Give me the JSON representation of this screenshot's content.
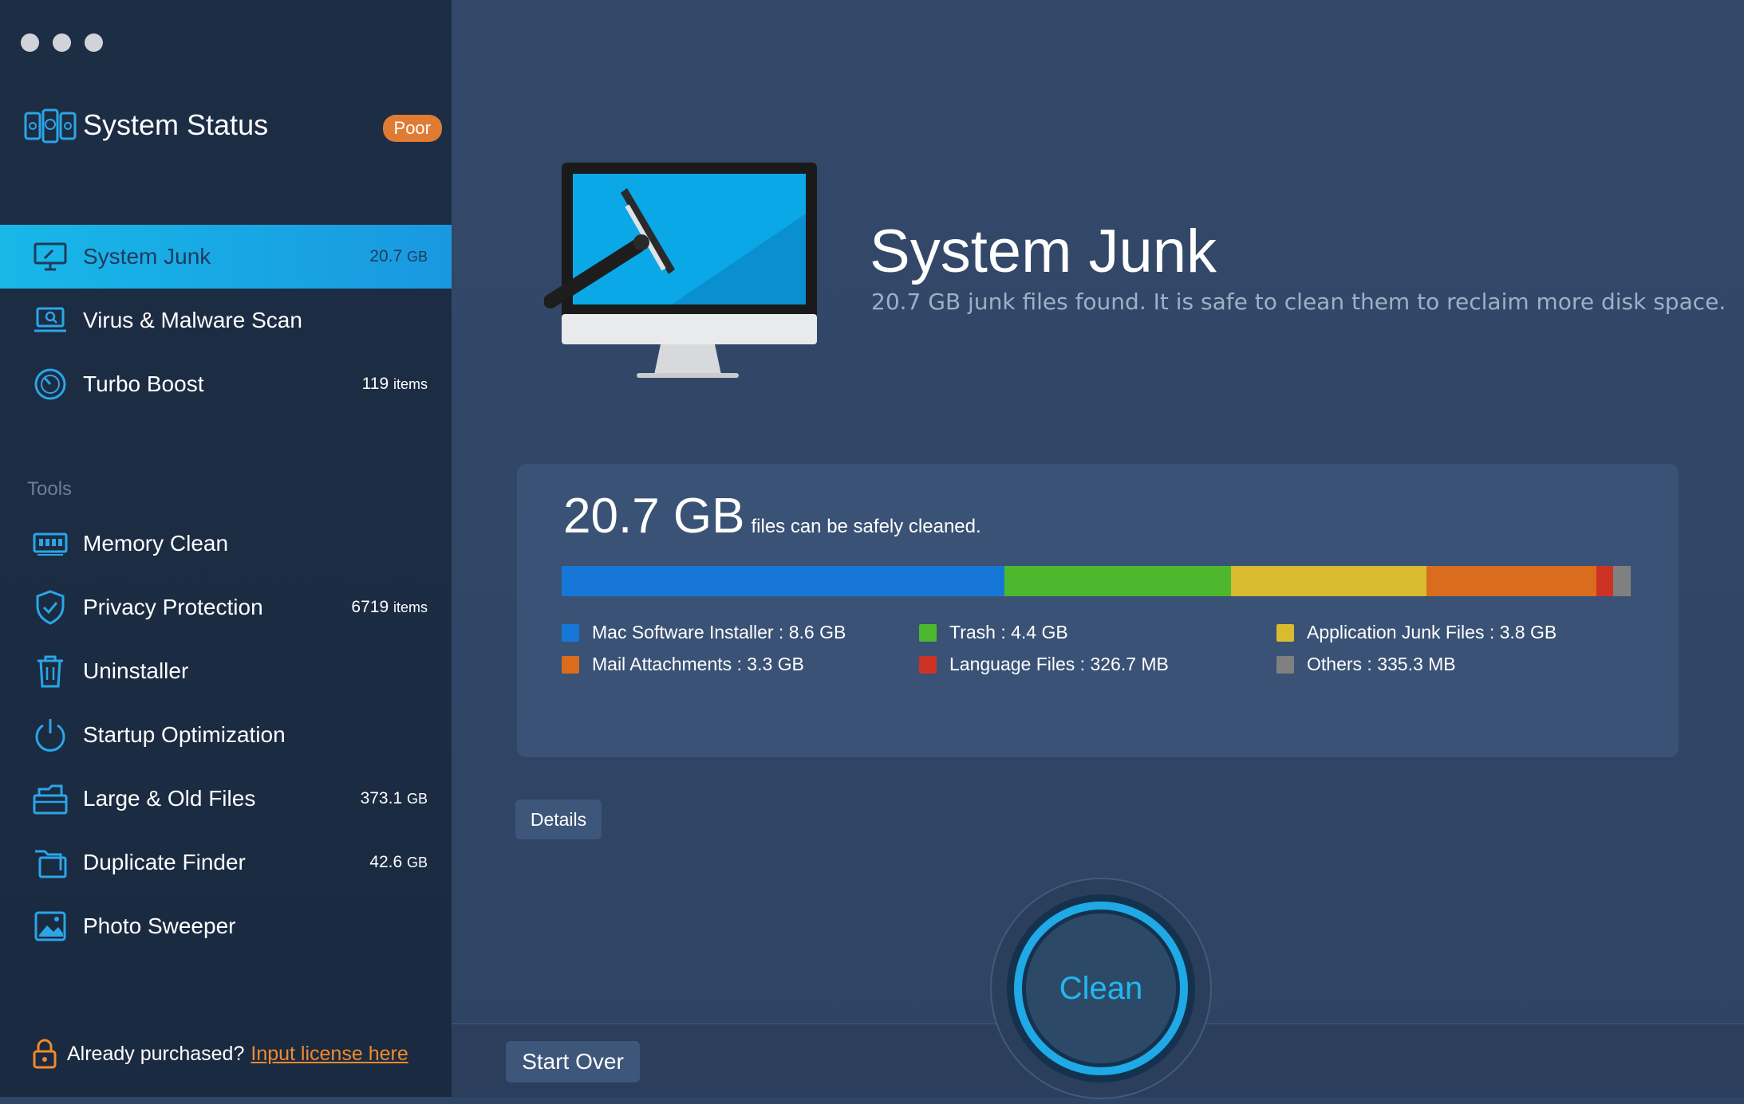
{
  "sidebar": {
    "status": {
      "title": "System Status",
      "badge": "Poor"
    },
    "items": [
      {
        "label": "System Junk",
        "meta_value": "20.7",
        "meta_unit": "GB",
        "active": true
      },
      {
        "label": "Virus & Malware Scan",
        "meta_value": "",
        "meta_unit": ""
      },
      {
        "label": "Turbo Boost",
        "meta_value": "119",
        "meta_unit": "items"
      }
    ],
    "tools_label": "Tools",
    "tools": [
      {
        "label": "Memory Clean",
        "meta_value": "",
        "meta_unit": ""
      },
      {
        "label": "Privacy Protection",
        "meta_value": "6719",
        "meta_unit": "items"
      },
      {
        "label": "Uninstaller",
        "meta_value": "",
        "meta_unit": ""
      },
      {
        "label": "Startup Optimization",
        "meta_value": "",
        "meta_unit": ""
      },
      {
        "label": "Large & Old Files",
        "meta_value": "373.1",
        "meta_unit": "GB"
      },
      {
        "label": "Duplicate Finder",
        "meta_value": "42.6",
        "meta_unit": "GB"
      },
      {
        "label": "Photo Sweeper",
        "meta_value": "",
        "meta_unit": ""
      }
    ],
    "license": {
      "text": "Already purchased?",
      "link": "Input license here"
    }
  },
  "main": {
    "title": "System Junk",
    "subtitle": "20.7 GB junk files found.  It is safe to clean them to reclaim more disk space.",
    "summary": {
      "amount": "20.7 GB",
      "text": "files can be safely cleaned."
    },
    "breakdown": [
      {
        "label": "Mac Software Installer : 8.6 GB",
        "value_gb": 8.6,
        "color": "#1677d9"
      },
      {
        "label": "Trash : 4.4 GB",
        "value_gb": 4.4,
        "color": "#4db82e"
      },
      {
        "label": "Application Junk Files : 3.8 GB",
        "value_gb": 3.8,
        "color": "#d8bb2e"
      },
      {
        "label": "Mail Attachments : 3.3 GB",
        "value_gb": 3.3,
        "color": "#d96c1d"
      },
      {
        "label": "Language Files : 326.7 MB",
        "value_gb": 0.3267,
        "color": "#cc3325"
      },
      {
        "label": "Others : 335.3 MB",
        "value_gb": 0.3353,
        "color": "#808080"
      }
    ],
    "details_button": "Details",
    "start_over_button": "Start Over",
    "clean_button": "Clean"
  }
}
